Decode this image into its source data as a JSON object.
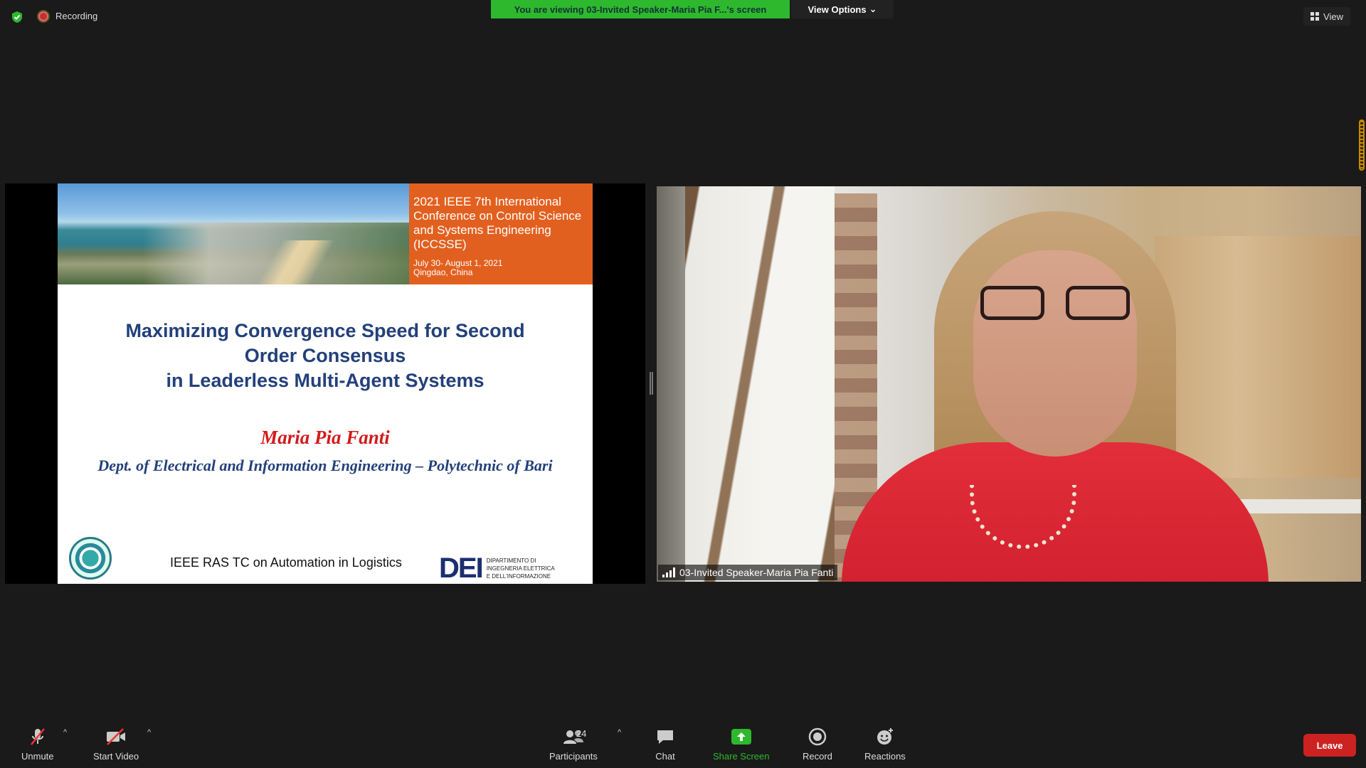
{
  "top": {
    "recording_label": "Recording",
    "viewing_banner": "You are viewing 03-Invited Speaker-Maria Pia F...'s screen",
    "view_options_label": "View Options",
    "view_label": "View"
  },
  "slide": {
    "conference_title": "2021 IEEE 7th International Conference on Control Science and Systems Engineering (ICCSSE)",
    "conference_date": "July 30- August 1, 2021",
    "conference_location": "Qingdao, China",
    "title": "Maximizing Convergence Speed for Second\nOrder Consensus\nin Leaderless Multi-Agent Systems",
    "author": "Maria Pia Fanti",
    "department": "Dept. of Electrical and Information Engineering – Polytechnic of Bari",
    "footer": "IEEE RAS TC on Automation in Logistics",
    "dei_mark": "DEI",
    "dei_line1": "DIPARTIMENTO DI",
    "dei_line2": "INGEGNERIA ELETTRICA",
    "dei_line3": "E DELL'INFORMAZIONE"
  },
  "video": {
    "participant_name": "03-Invited Speaker-Maria Pia Fanti"
  },
  "toolbar": {
    "unmute": "Unmute",
    "start_video": "Start Video",
    "participants": "Participants",
    "participant_count": "24",
    "chat": "Chat",
    "share_screen": "Share Screen",
    "record": "Record",
    "reactions": "Reactions",
    "leave": "Leave"
  },
  "colors": {
    "banner_green": "#2eb82e",
    "leave_red": "#cc2222",
    "slide_orange": "#e2601f",
    "slide_title_blue": "#23407a",
    "author_red": "#d11b1b"
  }
}
